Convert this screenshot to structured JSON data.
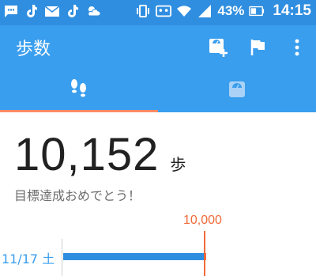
{
  "status_bar": {
    "battery_percent": "43%",
    "time": "14:15",
    "icons": [
      "message-icon",
      "tiktok-icon",
      "mail-icon",
      "tiktok-icon",
      "weather-icon",
      "vibrate-icon",
      "cassette-icon",
      "wifi-icon",
      "signal-icon",
      "battery-icon"
    ]
  },
  "app_bar": {
    "title": "歩数",
    "actions": [
      "add-weight-icon",
      "flag-icon",
      "more-vert-icon"
    ]
  },
  "tabs": [
    {
      "icon": "footsteps-icon",
      "selected": true
    },
    {
      "icon": "scale-icon",
      "selected": false
    }
  ],
  "summary": {
    "steps": "10,152",
    "unit": "歩",
    "message": "目標達成おめでとう！"
  },
  "chart": {
    "goal_label": "10,000",
    "goal_value": 10000,
    "date_label": "11/17 土",
    "steps_value": 10152
  },
  "colors": {
    "status_bar": "#2f8ee0",
    "app_bar": "#3a9eee",
    "accent": "#f06b3a",
    "bar": "#2f8ee0"
  }
}
